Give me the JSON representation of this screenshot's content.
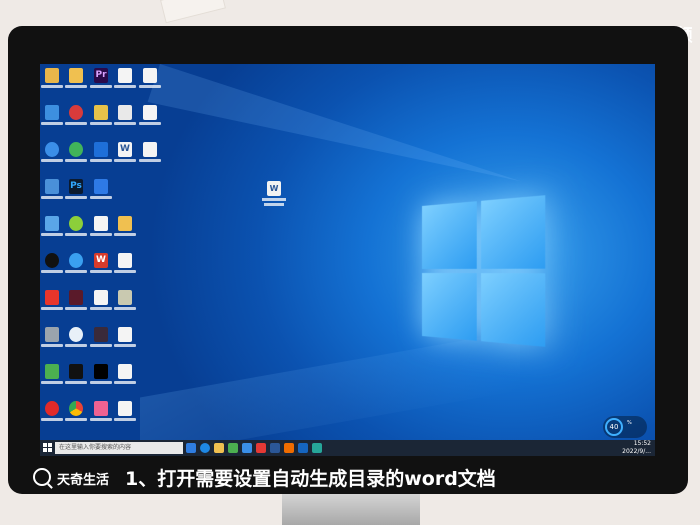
{
  "watermark": "天奇·视频",
  "caption": {
    "brand": "天奇生活",
    "text": "1、打开需要设置自动生成目录的word文档"
  },
  "taskbar": {
    "search_placeholder": "在这里输入你要搜索的内容",
    "time": "15:52",
    "date": "2022/9/..."
  },
  "gauge": {
    "value": "40",
    "unit": "%"
  },
  "desktop_file": {
    "icon_letter": "W"
  },
  "colors": {
    "desktop_blue": "#1472d4",
    "taskbar": "#1b2636",
    "word_blue": "#2b5797"
  }
}
